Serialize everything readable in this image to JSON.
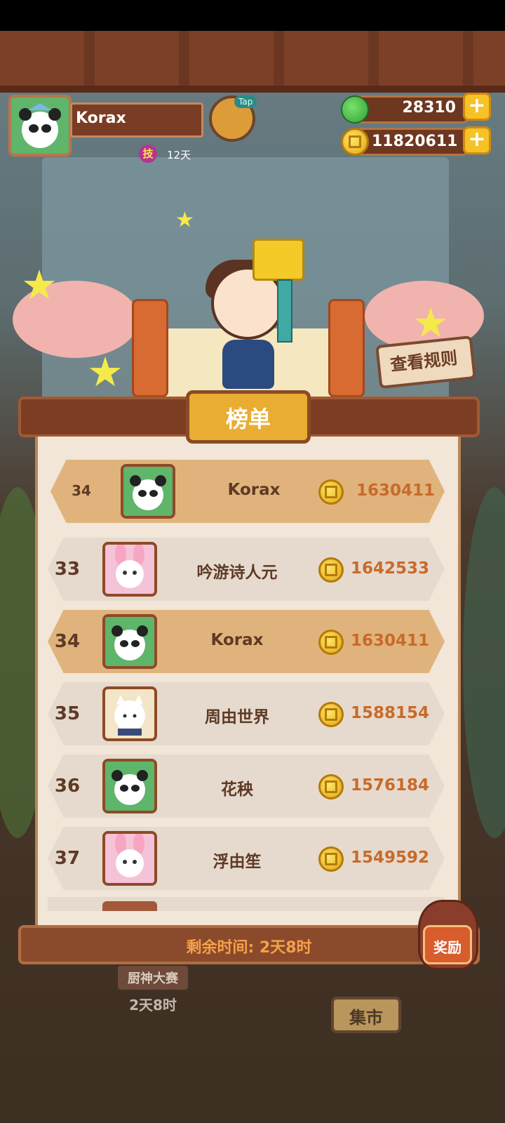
{
  "player": {
    "name": "Korax",
    "skill_badge": "技",
    "skill_days": "12天",
    "tap_label": "Tap"
  },
  "currency": {
    "gems": "28310",
    "coins": "11820611"
  },
  "stage": {
    "rules_button": "查看规则"
  },
  "leaderboard": {
    "title": "榜单",
    "pinned": {
      "rank": "34",
      "name": "Korax",
      "score": "1630411"
    },
    "rows": [
      {
        "rank": "33",
        "name": "吟游诗人元",
        "score": "1642533",
        "avatar": "bunny-avatar"
      },
      {
        "rank": "34",
        "name": "Korax",
        "score": "1630411",
        "avatar": "panda-avatar"
      },
      {
        "rank": "35",
        "name": "周由世界",
        "score": "1588154",
        "avatar": "cat-avatar"
      },
      {
        "rank": "36",
        "name": "花秧",
        "score": "1576184",
        "avatar": "panda-avatar"
      },
      {
        "rank": "37",
        "name": "浮由笙",
        "score": "1549592",
        "avatar": "bunny-avatar"
      }
    ],
    "time_remaining": "剩余时间: 2天8时",
    "reward_label": "奖励"
  },
  "background": {
    "event_sign": "厨神大赛",
    "event_time": "2天8时",
    "market_sign": "集市"
  },
  "colors": {
    "highlight_row": "#e1b37c",
    "row": "#e6dace",
    "score": "#c86a2a",
    "title_plaque": "#e8ad32"
  }
}
